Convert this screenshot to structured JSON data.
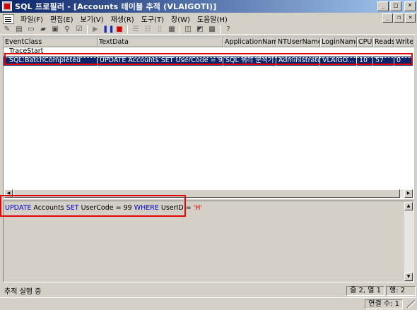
{
  "window": {
    "title": "SQL 프로필러 - [Accounts 테이블 추적 (VLAIGOTI)]",
    "buttons": {
      "minimize": "_",
      "maximize": "□",
      "close": "×"
    }
  },
  "menu": {
    "items": [
      "파일(F)",
      "편집(E)",
      "보기(V)",
      "재생(R)",
      "도구(T)",
      "창(W)",
      "도움말(H)"
    ],
    "mdi_buttons": {
      "minimize": "_",
      "restore": "❐",
      "close": "×"
    }
  },
  "toolbar": {
    "icons": [
      "new-trace-icon",
      "new-document-icon",
      "open-icon",
      "open-folder-icon",
      "save-icon",
      "find-icon",
      "properties-icon",
      "run-icon",
      "pause-icon",
      "stop-icon",
      "step-icon",
      "run-to-cursor-icon",
      "breakpoint-icon",
      "output-window-icon",
      "trace-settings-icon",
      "query-analyzer-icon",
      "filter-icon",
      "help-icon"
    ]
  },
  "grid": {
    "columns": [
      "EventClass",
      "TextData",
      "ApplicationName",
      "NTUserName",
      "LoginName",
      "CPU",
      "Reads",
      "Writes"
    ],
    "rows": [
      {
        "event": "TraceStart",
        "text": "",
        "app": "",
        "nt_user": "",
        "login": "",
        "cpu": "",
        "reads": "",
        "writes": ""
      },
      {
        "event": "SQL:BatchCompleted",
        "text": "UPDATE Accounts SET UserCode = 9...",
        "app": "SQL 쿼리 분석기",
        "nt_user": "Administrator",
        "login": "VLAIGO...",
        "cpu": "10",
        "reads": "57",
        "writes": "0"
      }
    ]
  },
  "sql_text": {
    "kw_update": "UPDATE",
    "part1": " Accounts ",
    "kw_set": "SET",
    "part2": " UserCode = 99 ",
    "kw_where": "WHERE",
    "part3": " UserID = ",
    "str_value": "'H'"
  },
  "status": {
    "message": "추적 실행 중",
    "position": "줄 2, 열 1",
    "row": "행: 2",
    "connections": "연결 수: 1"
  },
  "colors": {
    "title_bar": "#0a246a",
    "selection": "#0a246a",
    "highlight_box": "#e00000",
    "keyword": "#0000c8",
    "string": "#d40000"
  }
}
